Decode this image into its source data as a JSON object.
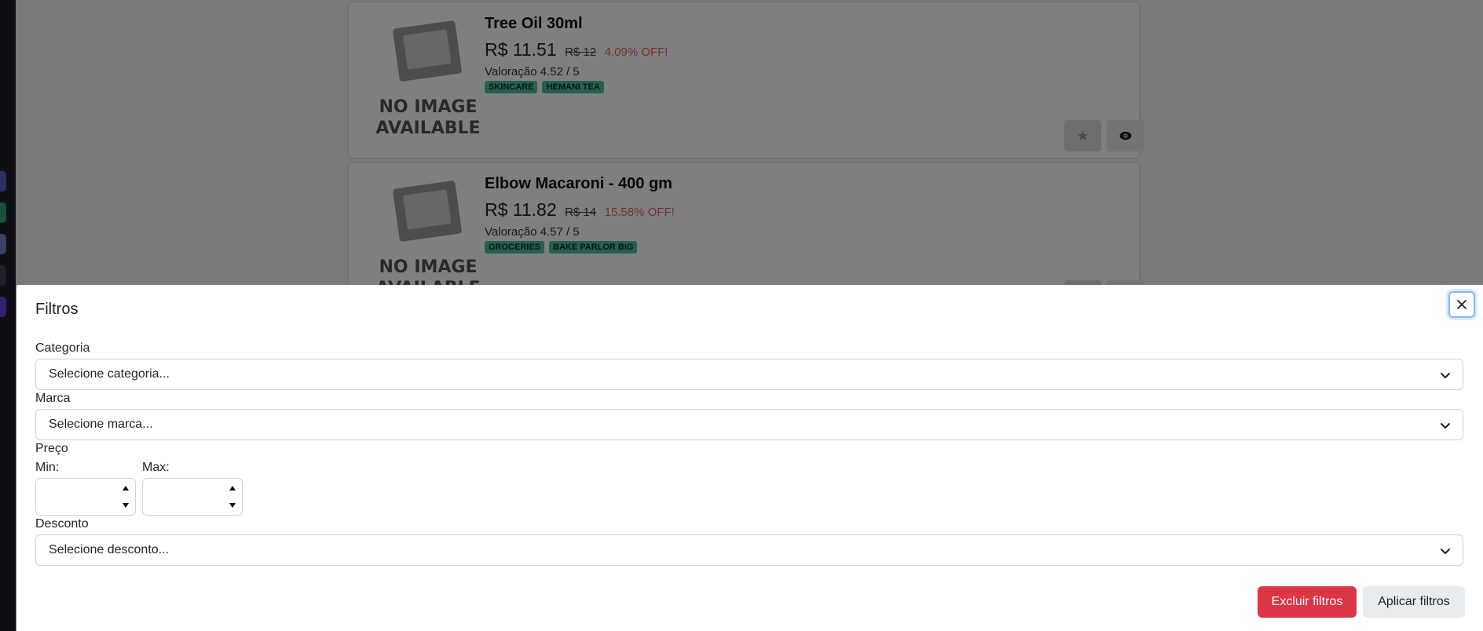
{
  "products": [
    {
      "name": "Tree Oil 30ml",
      "image_text": [
        "NO IMAGE",
        "AVAILABLE"
      ],
      "price": "R$ 11.51",
      "old_price": "R$ 12",
      "discount": "4.09% OFF!",
      "rating": "Valoração 4.52 / 5",
      "tags": [
        "SKINCARE",
        "HEMANI TEA"
      ]
    },
    {
      "name": "Elbow Macaroni - 400 gm",
      "image_text": [
        "NO IMAGE",
        "AVAILABLE"
      ],
      "price": "R$ 11.82",
      "old_price": "R$ 14",
      "discount": "15.58% OFF!",
      "rating": "Valoração 4.57 / 5",
      "tags": [
        "GROCERIES",
        "BAKE PARLOR BIG"
      ]
    }
  ],
  "filters": {
    "title": "Filtros",
    "category": {
      "label": "Categoria",
      "placeholder": "Selecione categoria..."
    },
    "brand": {
      "label": "Marca",
      "placeholder": "Selecione marca..."
    },
    "price": {
      "label": "Preço",
      "min_label": "Min:",
      "max_label": "Max:",
      "min_value": "",
      "max_value": ""
    },
    "discount": {
      "label": "Desconto",
      "placeholder": "Selecione desconto..."
    },
    "clear_button": "Excluir filtros",
    "apply_button": "Aplicar filtros"
  },
  "colors": {
    "danger": "#dc3545",
    "tag": "#4cc1a3",
    "discount_text": "#e8625a",
    "focus_ring": "#86b7fe"
  }
}
